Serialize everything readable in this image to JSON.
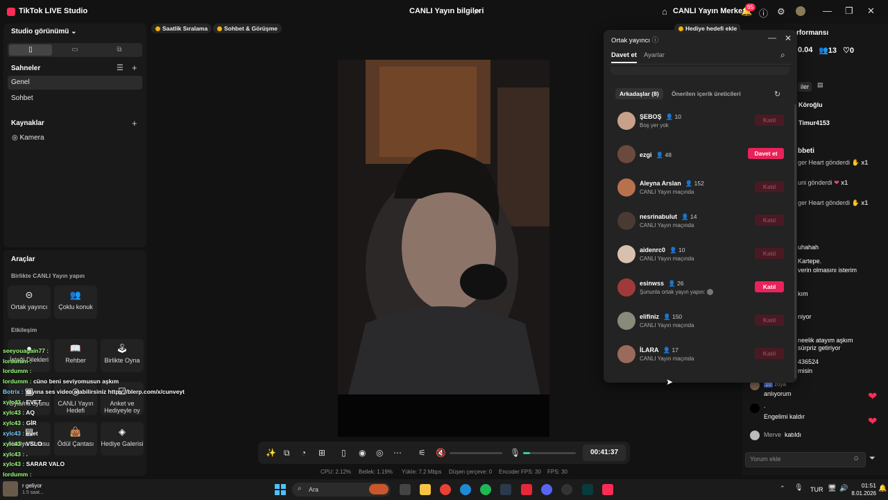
{
  "app": {
    "title": "TikTok LIVE Studio",
    "center_title": "CANLI Yayın bilgileri",
    "center_title_right": "CANLI Yayın Merkezi",
    "notif_count": "65"
  },
  "left": {
    "studio_view": "Studio görünümü",
    "scenes_title": "Sahneler",
    "scenes": [
      "Genel",
      "Sohbet"
    ],
    "sources_title": "Kaynaklar",
    "sources": [
      "Kamera"
    ],
    "tools_title": "Araçlar",
    "together_title": "Birlikte CANLI Yayın yapın",
    "together_btns": [
      "Ortak yayıncı",
      "Çoklu konuk"
    ],
    "interaction_title": "Etkileşim",
    "interaction_btns": [
      "İsteği Dilekleri",
      "Rehber",
      "Birlikte Oyna",
      "Oylama oyunu",
      "CANLI Yayın Hedefi",
      "Anket ve Hediyeyle oy",
      "Hediye Kutusu",
      "Ödül Çantası",
      "Hediye Galerisi"
    ]
  },
  "chat_overlay": [
    {
      "u": "seeyouagain77 :",
      "t": ""
    },
    {
      "u": "lordumm :",
      "t": ""
    },
    {
      "u": "lordumm :",
      "t": ""
    },
    {
      "u": "lordumm :",
      "t": "cüno beni seviyomusun aşkım"
    },
    {
      "u": "Botrix :",
      "t": "Yayına ses video atabilirsiniz https://blerp.com/x/cunveyt"
    },
    {
      "u": "xylc43 :",
      "t": "EVET"
    },
    {
      "u": "xylc43 :",
      "t": "AQ"
    },
    {
      "u": "xylc43 :",
      "t": "GİR"
    },
    {
      "u": "xylc43 :",
      "t": "evet"
    },
    {
      "u": "xylc43 :",
      "t": "VSLO"
    },
    {
      "u": "xylc43 :",
      "t": "."
    },
    {
      "u": "xylc43 :",
      "t": "SARAR VALO"
    },
    {
      "u": "lordumm :",
      "t": ""
    },
    {
      "u": "lordumm :",
      "t": ""
    },
    {
      "u": "lordumm :",
      "t": ""
    }
  ],
  "top_pills": [
    "Saatlik Sıralama",
    "Sohbet & Görüşme",
    "Hediye hedefi ekle"
  ],
  "control": {
    "timer": "00:41:37"
  },
  "stats": [
    "CPU: 2.12%",
    "Bellek: 1.19%",
    "Yükle: 7.2 Mbps",
    "Düşen çerçeve: 0",
    "Encoder FPS: 30",
    "FPS: 30"
  ],
  "modal": {
    "title": "Ortak yayıncı",
    "tabs": [
      "Davet et",
      "Ayarlar"
    ],
    "subtabs": [
      "Arkadaşlar (8)",
      "Önerilen içerik üreticileri"
    ],
    "friends": [
      {
        "name": "ŞEBOŞ",
        "count": "10",
        "sub": "Boş yer yok",
        "btn": "Katıl",
        "active": false,
        "color": "#c9a08a"
      },
      {
        "name": "ezgi",
        "count": "48",
        "sub": "",
        "btn": "Davet et",
        "active": true,
        "color": "#6b4a3e"
      },
      {
        "name": "Aleyna Arslan",
        "count": "152",
        "sub": "CANLI Yayın maçında",
        "btn": "Katıl",
        "active": false,
        "color": "#b8714e"
      },
      {
        "name": "nesrinabulut",
        "count": "14",
        "sub": "CANLI Yayın maçında",
        "btn": "Katıl",
        "active": false,
        "color": "#4a3a34"
      },
      {
        "name": "aidenrc0",
        "count": "10",
        "sub": "CANLI Yayın maçında",
        "btn": "Katıl",
        "active": false,
        "color": "#d8c0b0"
      },
      {
        "name": "esinwss",
        "count": "26",
        "sub": "Şununla ortak yayın yapın:",
        "btn": "Katıl",
        "active": true,
        "color": "#a03a3a"
      },
      {
        "name": "elifiniz",
        "count": "150",
        "sub": "CANLI Yayın maçında",
        "btn": "Katıl",
        "active": false,
        "color": "#8a8a7a"
      },
      {
        "name": "İLARA",
        "count": "17",
        "sub": "CANLI Yayın maçında",
        "btn": "Katıl",
        "active": false,
        "color": "#9a6a5a"
      }
    ]
  },
  "right": {
    "performance_title": "rformansı",
    "stats": [
      "0.04",
      "13",
      "0"
    ],
    "tabs": [
      "iler"
    ],
    "users": [
      "Köroğlu",
      "Timur4153"
    ],
    "gifts_title": "bbeti",
    "gifts": [
      {
        "t": "ger Heart gönderdi",
        "x": "x1"
      },
      {
        "t": "uni gönderdi",
        "x": "x1"
      },
      {
        "t": "ger Heart gönderdi",
        "x": "x1"
      }
    ],
    "chat": [
      "uhahah",
      "Kartepe.",
      "verin olmasını isterim",
      "kım",
      "niyor",
      "neelik atayım aşkım",
      "sürpriz getiriyor",
      "436524",
      "misin",
      "anlıyorum",
      "Engelimi kaldır",
      "katıldı"
    ],
    "chat_users": {
      "zoya": "zoya",
      "merve": "Merve"
    },
    "chat_level": "10",
    "comment_placeholder": "Yorum ekle"
  },
  "taskbar": {
    "search": "Ara",
    "lang": "TUR",
    "time": "01:51",
    "date": "8.01.2026",
    "notif_title": "r geliyor",
    "notif_sub": "1.5 saat..."
  }
}
